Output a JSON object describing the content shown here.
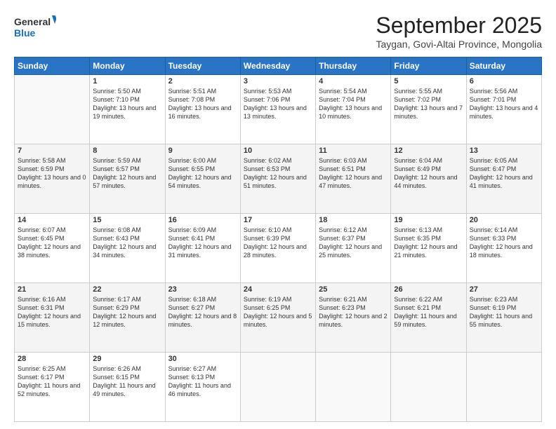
{
  "header": {
    "logo_line1": "General",
    "logo_line2": "Blue",
    "month": "September 2025",
    "location": "Taygan, Govi-Altai Province, Mongolia"
  },
  "days": [
    "Sunday",
    "Monday",
    "Tuesday",
    "Wednesday",
    "Thursday",
    "Friday",
    "Saturday"
  ],
  "weeks": [
    [
      {
        "num": "",
        "empty": true
      },
      {
        "num": "1",
        "sunrise": "5:50 AM",
        "sunset": "7:10 PM",
        "daylight": "13 hours and 19 minutes."
      },
      {
        "num": "2",
        "sunrise": "5:51 AM",
        "sunset": "7:08 PM",
        "daylight": "13 hours and 16 minutes."
      },
      {
        "num": "3",
        "sunrise": "5:53 AM",
        "sunset": "7:06 PM",
        "daylight": "13 hours and 13 minutes."
      },
      {
        "num": "4",
        "sunrise": "5:54 AM",
        "sunset": "7:04 PM",
        "daylight": "13 hours and 10 minutes."
      },
      {
        "num": "5",
        "sunrise": "5:55 AM",
        "sunset": "7:02 PM",
        "daylight": "13 hours and 7 minutes."
      },
      {
        "num": "6",
        "sunrise": "5:56 AM",
        "sunset": "7:01 PM",
        "daylight": "13 hours and 4 minutes."
      }
    ],
    [
      {
        "num": "7",
        "sunrise": "5:58 AM",
        "sunset": "6:59 PM",
        "daylight": "13 hours and 0 minutes."
      },
      {
        "num": "8",
        "sunrise": "5:59 AM",
        "sunset": "6:57 PM",
        "daylight": "12 hours and 57 minutes."
      },
      {
        "num": "9",
        "sunrise": "6:00 AM",
        "sunset": "6:55 PM",
        "daylight": "12 hours and 54 minutes."
      },
      {
        "num": "10",
        "sunrise": "6:02 AM",
        "sunset": "6:53 PM",
        "daylight": "12 hours and 51 minutes."
      },
      {
        "num": "11",
        "sunrise": "6:03 AM",
        "sunset": "6:51 PM",
        "daylight": "12 hours and 47 minutes."
      },
      {
        "num": "12",
        "sunrise": "6:04 AM",
        "sunset": "6:49 PM",
        "daylight": "12 hours and 44 minutes."
      },
      {
        "num": "13",
        "sunrise": "6:05 AM",
        "sunset": "6:47 PM",
        "daylight": "12 hours and 41 minutes."
      }
    ],
    [
      {
        "num": "14",
        "sunrise": "6:07 AM",
        "sunset": "6:45 PM",
        "daylight": "12 hours and 38 minutes."
      },
      {
        "num": "15",
        "sunrise": "6:08 AM",
        "sunset": "6:43 PM",
        "daylight": "12 hours and 34 minutes."
      },
      {
        "num": "16",
        "sunrise": "6:09 AM",
        "sunset": "6:41 PM",
        "daylight": "12 hours and 31 minutes."
      },
      {
        "num": "17",
        "sunrise": "6:10 AM",
        "sunset": "6:39 PM",
        "daylight": "12 hours and 28 minutes."
      },
      {
        "num": "18",
        "sunrise": "6:12 AM",
        "sunset": "6:37 PM",
        "daylight": "12 hours and 25 minutes."
      },
      {
        "num": "19",
        "sunrise": "6:13 AM",
        "sunset": "6:35 PM",
        "daylight": "12 hours and 21 minutes."
      },
      {
        "num": "20",
        "sunrise": "6:14 AM",
        "sunset": "6:33 PM",
        "daylight": "12 hours and 18 minutes."
      }
    ],
    [
      {
        "num": "21",
        "sunrise": "6:16 AM",
        "sunset": "6:31 PM",
        "daylight": "12 hours and 15 minutes."
      },
      {
        "num": "22",
        "sunrise": "6:17 AM",
        "sunset": "6:29 PM",
        "daylight": "12 hours and 12 minutes."
      },
      {
        "num": "23",
        "sunrise": "6:18 AM",
        "sunset": "6:27 PM",
        "daylight": "12 hours and 8 minutes."
      },
      {
        "num": "24",
        "sunrise": "6:19 AM",
        "sunset": "6:25 PM",
        "daylight": "12 hours and 5 minutes."
      },
      {
        "num": "25",
        "sunrise": "6:21 AM",
        "sunset": "6:23 PM",
        "daylight": "12 hours and 2 minutes."
      },
      {
        "num": "26",
        "sunrise": "6:22 AM",
        "sunset": "6:21 PM",
        "daylight": "11 hours and 59 minutes."
      },
      {
        "num": "27",
        "sunrise": "6:23 AM",
        "sunset": "6:19 PM",
        "daylight": "11 hours and 55 minutes."
      }
    ],
    [
      {
        "num": "28",
        "sunrise": "6:25 AM",
        "sunset": "6:17 PM",
        "daylight": "11 hours and 52 minutes."
      },
      {
        "num": "29",
        "sunrise": "6:26 AM",
        "sunset": "6:15 PM",
        "daylight": "11 hours and 49 minutes."
      },
      {
        "num": "30",
        "sunrise": "6:27 AM",
        "sunset": "6:13 PM",
        "daylight": "11 hours and 46 minutes."
      },
      {
        "num": "",
        "empty": true
      },
      {
        "num": "",
        "empty": true
      },
      {
        "num": "",
        "empty": true
      },
      {
        "num": "",
        "empty": true
      }
    ]
  ]
}
